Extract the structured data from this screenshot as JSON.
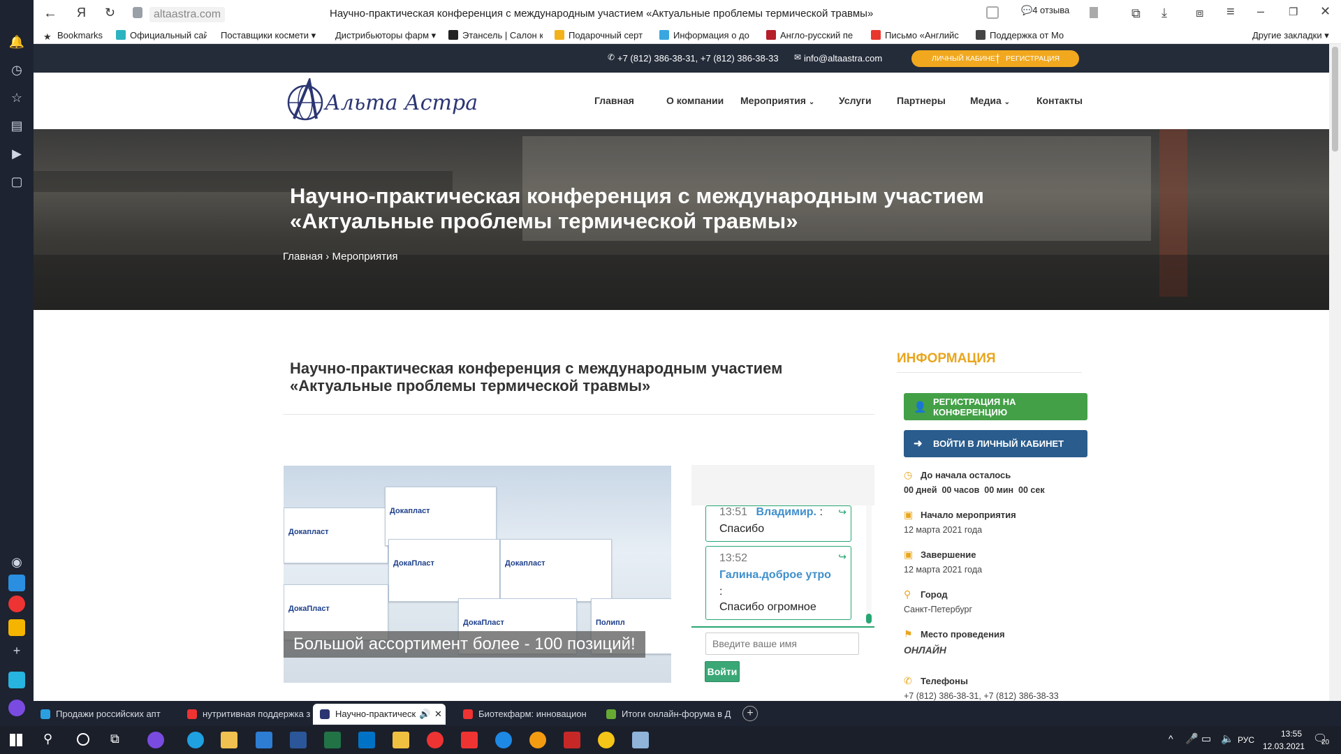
{
  "browser": {
    "url": "altaastra.com",
    "title": "Научно-практическая конференция с международным участием «Актуальные проблемы термической травмы»",
    "reviews_badge": "4 отзыва",
    "bookmarks": [
      "Bookmarks",
      "Официальный сай",
      "Поставщики космети",
      "Дистрибьюторы фарм",
      "Этансель | Салон к",
      "Подарочный серт",
      "Информация о до",
      "Англо-русский пе",
      "Письмо «Английс",
      "Поддержка от Мо"
    ],
    "bookmarks_other": "Другие закладки"
  },
  "site": {
    "topbar": {
      "phones": "+7 (812) 386-38-31, +7 (812) 386-38-33",
      "email": "info@altaastra.com",
      "cabinet": "ЛИЧНЫЙ КАБИНЕТ",
      "register": "РЕГИСТРАЦИЯ"
    },
    "logo_text": "Альта Астра",
    "nav": [
      "Главная",
      "О компании",
      "Мероприятия",
      "Услуги",
      "Партнеры",
      "Медиа",
      "Контакты"
    ],
    "hero": {
      "title": "Научно-практическая конференция с международным участием «Актуальные проблемы термической травмы»",
      "crumb_home": "Главная",
      "crumb_sep": "›",
      "crumb_current": "Мероприятия"
    },
    "main_title": "Научно-практическая конференция с международным участием «Актуальные проблемы термической травмы»",
    "banner": {
      "caption": "Большой ассортимент более - 100 позиций!",
      "box_labels": [
        "Докапласт",
        "ДокаПласт",
        "Докапласт",
        "ДокаПласт",
        "Полипл"
      ]
    },
    "chat": {
      "messages": [
        {
          "time": "13:51",
          "name": "Владимир.",
          "sep": ":",
          "text": "Спасибо"
        },
        {
          "time": "13:52",
          "name": "Галина.доброе утро",
          "sep": ":",
          "text": "Спасибо огромное"
        }
      ],
      "input_placeholder": "Введите ваше имя",
      "login_button": "Войти"
    },
    "info": {
      "heading": "ИНФОРМАЦИЯ",
      "btn_register": "РЕГИСТРАЦИЯ НА КОНФЕРЕНЦИЮ",
      "btn_login": "ВОЙТИ В ЛИЧНЫЙ КАБИНЕТ",
      "countdown_label": "До начала осталось",
      "countdown_value": "00 дней  00 часов  00 мин  00 сек",
      "start_label": "Начало мероприятия",
      "start_value": "12 марта 2021 года",
      "end_label": "Завершение",
      "end_value": "12 марта 2021 года",
      "city_label": "Город",
      "city_value": "Санкт-Петербург",
      "venue_label": "Место проведения",
      "venue_value": "ОНЛАЙН",
      "phones_label": "Телефоны",
      "phones_value": "+7 (812) 386-38-31, +7 (812) 386-38-33"
    },
    "colors": {
      "accent_orange": "#f1a81f",
      "green": "#3aa876",
      "blue_btn": "#2a5c8d",
      "dark_bar": "#242c3a"
    }
  },
  "tabs": [
    "Продажи российских апт",
    "нутритивная поддержка з",
    "Научно-практическ",
    "Биотекфарм: инновацион",
    "Итоги онлайн-форума в Д"
  ],
  "taskbar": {
    "lang": "РУС",
    "time": "13:55",
    "date": "12.03.2021",
    "notifications": "20"
  }
}
